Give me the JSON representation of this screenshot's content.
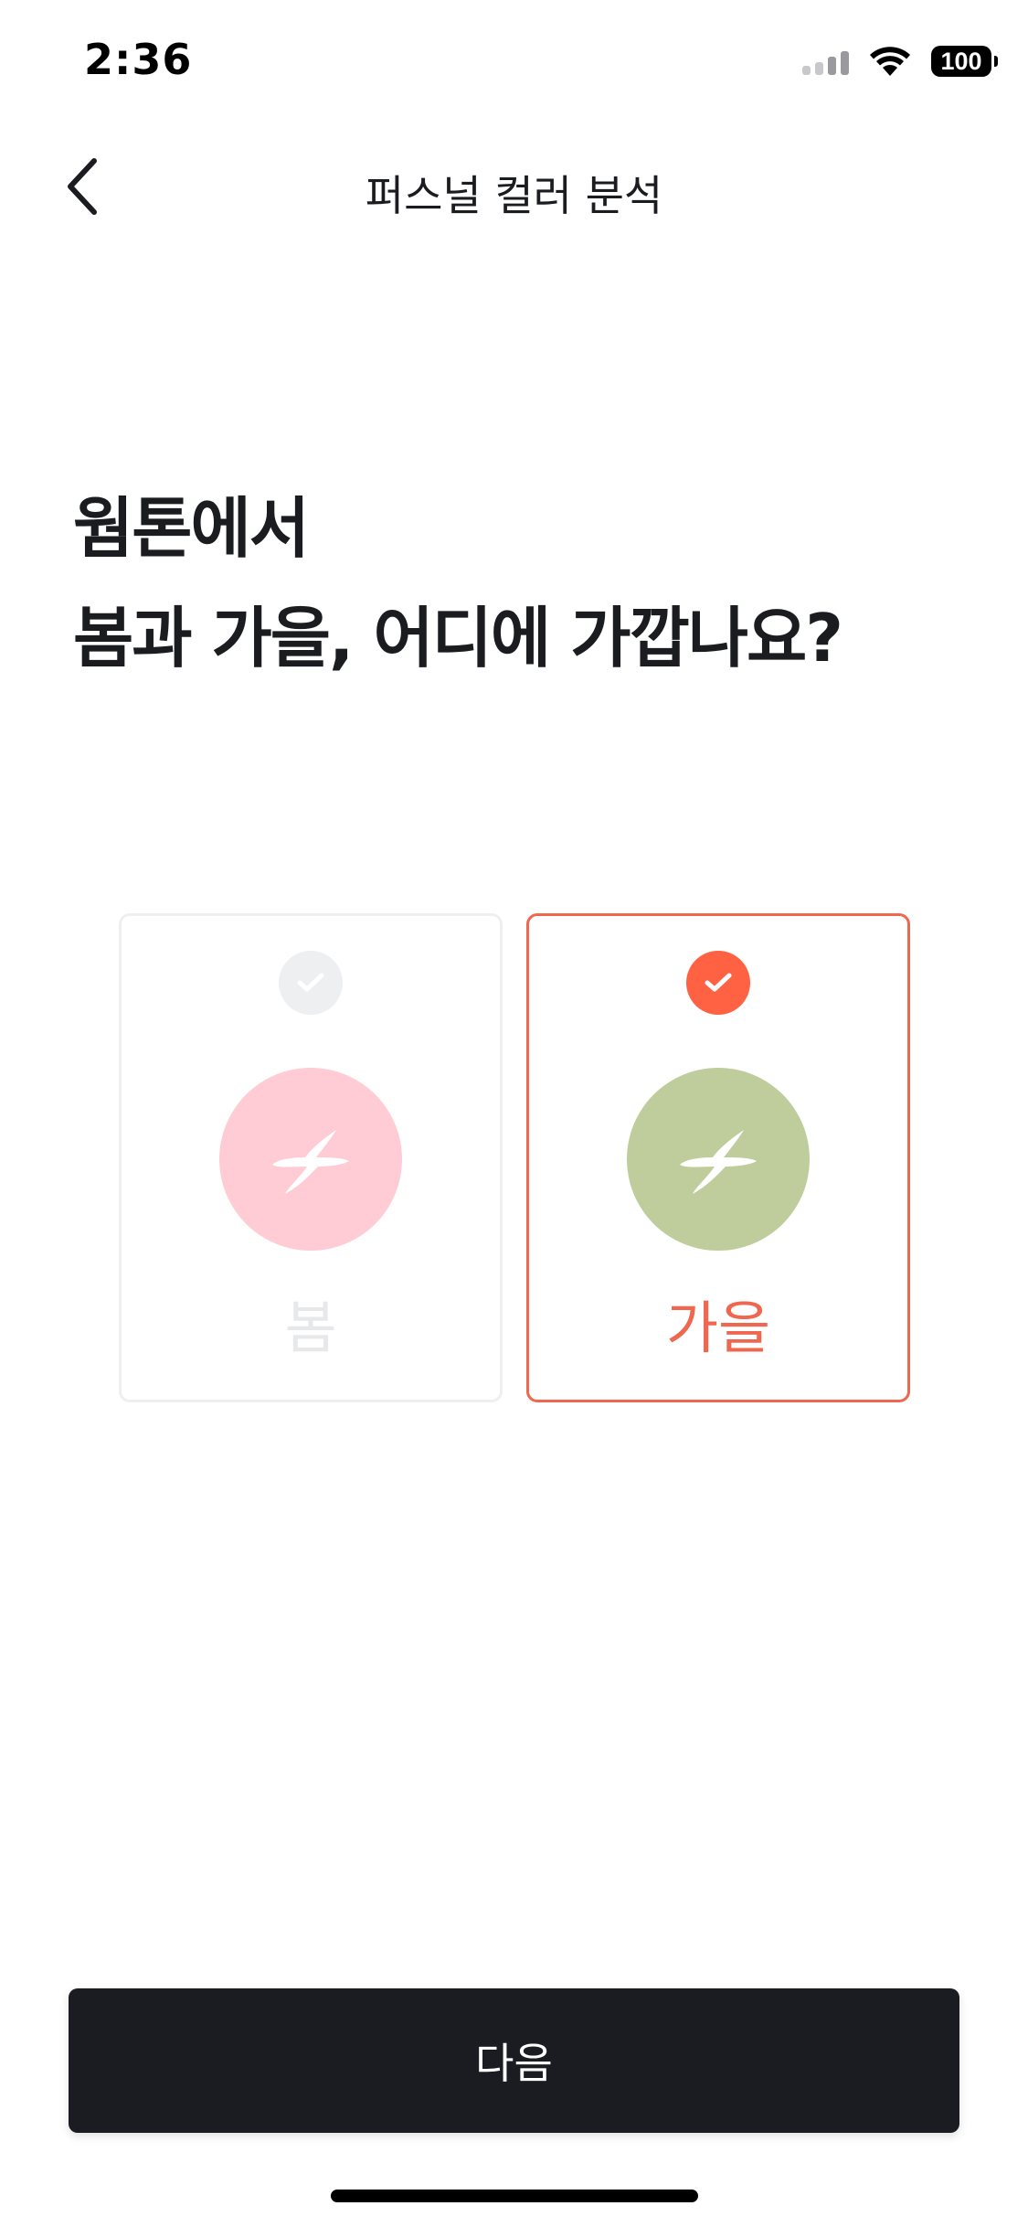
{
  "status_bar": {
    "time": "2:36",
    "battery": "100"
  },
  "nav": {
    "title": "퍼스널 컬러 분석",
    "back_icon": "chevron-left-icon"
  },
  "question": {
    "line1": "웜톤에서",
    "line2": "봄과 가을, 어디에 가깝나요?"
  },
  "options": [
    {
      "label": "봄",
      "selected": false,
      "swatch_color": "#ffcbd4",
      "check_color": "#eeeff1",
      "icon": "sparkle-icon"
    },
    {
      "label": "가을",
      "selected": true,
      "swatch_color": "#bfcd9c",
      "check_color": "#ff6243",
      "icon": "sparkle-icon"
    }
  ],
  "next_button": {
    "label": "다음"
  },
  "colors": {
    "accent": "#f0674f",
    "button_bg": "#1a1c22",
    "text": "#1b1c20"
  }
}
